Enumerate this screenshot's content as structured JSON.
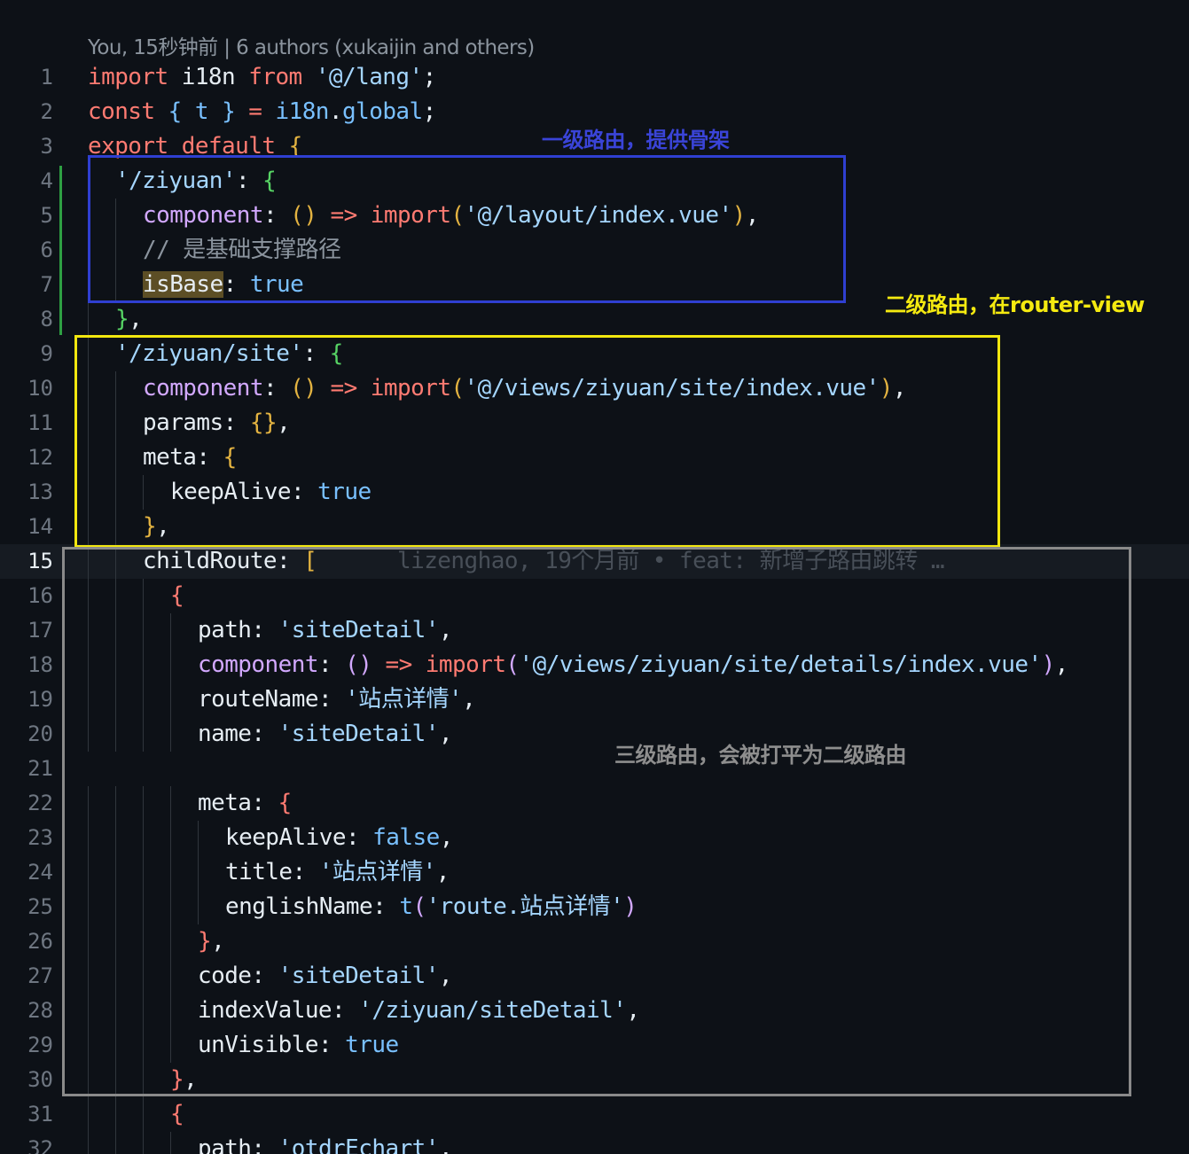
{
  "editor": {
    "codelens": "You, 15秒钟前 | 6 authors (xukaijin and others)",
    "colors": {
      "background": "#0d1117",
      "keyword": "#ff7b72",
      "string": "#a5d6ff",
      "property": "#d2a8ff",
      "boolean": "#79c0ff",
      "comment": "#8b949e",
      "git_added_bar": "#2ea043"
    },
    "current_line": 15,
    "lines": [
      {
        "n": "1",
        "indent": 0,
        "tokens": [
          {
            "t": "import",
            "s": "kw"
          },
          {
            "t": " i18n ",
            "s": "var"
          },
          {
            "t": "from",
            "s": "kw"
          },
          {
            "t": " ",
            "s": "var"
          },
          {
            "t": "'@/lang'",
            "s": "str"
          },
          {
            "t": ";",
            "s": "pun"
          }
        ]
      },
      {
        "n": "2",
        "indent": 0,
        "tokens": [
          {
            "t": "const",
            "s": "kw"
          },
          {
            "t": " ",
            "s": "var"
          },
          {
            "t": "{",
            "s": "b4"
          },
          {
            "t": " t ",
            "s": "bool"
          },
          {
            "t": "}",
            "s": "b4"
          },
          {
            "t": " = ",
            "s": "kw"
          },
          {
            "t": "i18n",
            "s": "bool"
          },
          {
            "t": ".",
            "s": "pun"
          },
          {
            "t": "global",
            "s": "bool"
          },
          {
            "t": ";",
            "s": "pun"
          }
        ]
      },
      {
        "n": "3",
        "indent": 0,
        "tokens": [
          {
            "t": "export",
            "s": "kw"
          },
          {
            "t": " ",
            "s": "var"
          },
          {
            "t": "default",
            "s": "kw"
          },
          {
            "t": " ",
            "s": "var"
          },
          {
            "t": "{",
            "s": "b1"
          }
        ]
      },
      {
        "n": "4",
        "indent": 1,
        "tokens": [
          {
            "t": "'/ziyuan'",
            "s": "str"
          },
          {
            "t": ": ",
            "s": "pun"
          },
          {
            "t": "{",
            "s": "b2"
          }
        ]
      },
      {
        "n": "5",
        "indent": 2,
        "tokens": [
          {
            "t": "component",
            "s": "prop"
          },
          {
            "t": ": ",
            "s": "pun"
          },
          {
            "t": "()",
            "s": "b1"
          },
          {
            "t": " => ",
            "s": "kw"
          },
          {
            "t": "import",
            "s": "kw"
          },
          {
            "t": "(",
            "s": "b1"
          },
          {
            "t": "'@/layout/index.vue'",
            "s": "str"
          },
          {
            "t": ")",
            "s": "b1"
          },
          {
            "t": ",",
            "s": "pun"
          }
        ]
      },
      {
        "n": "6",
        "indent": 2,
        "tokens": [
          {
            "t": "// 是基础支撑路径",
            "s": "com"
          }
        ]
      },
      {
        "n": "7",
        "indent": 2,
        "tokens": [
          {
            "t": "isBase",
            "s": "var",
            "hl": true
          },
          {
            "t": ": ",
            "s": "pun"
          },
          {
            "t": "true",
            "s": "bool"
          }
        ]
      },
      {
        "n": "8",
        "indent": 1,
        "tokens": [
          {
            "t": "}",
            "s": "b2"
          },
          {
            "t": ",",
            "s": "pun"
          }
        ]
      },
      {
        "n": "9",
        "indent": 1,
        "tokens": [
          {
            "t": "'/ziyuan/site'",
            "s": "str"
          },
          {
            "t": ": ",
            "s": "pun"
          },
          {
            "t": "{",
            "s": "b2"
          }
        ]
      },
      {
        "n": "10",
        "indent": 2,
        "tokens": [
          {
            "t": "component",
            "s": "prop"
          },
          {
            "t": ": ",
            "s": "pun"
          },
          {
            "t": "()",
            "s": "b1"
          },
          {
            "t": " => ",
            "s": "kw"
          },
          {
            "t": "import",
            "s": "kw"
          },
          {
            "t": "(",
            "s": "b1"
          },
          {
            "t": "'@/views/ziyuan/site/index.vue'",
            "s": "str"
          },
          {
            "t": ")",
            "s": "b1"
          },
          {
            "t": ",",
            "s": "pun"
          }
        ]
      },
      {
        "n": "11",
        "indent": 2,
        "tokens": [
          {
            "t": "params",
            "s": "var"
          },
          {
            "t": ": ",
            "s": "pun"
          },
          {
            "t": "{}",
            "s": "b1"
          },
          {
            "t": ",",
            "s": "pun"
          }
        ]
      },
      {
        "n": "12",
        "indent": 2,
        "tokens": [
          {
            "t": "meta",
            "s": "var"
          },
          {
            "t": ": ",
            "s": "pun"
          },
          {
            "t": "{",
            "s": "b1"
          }
        ]
      },
      {
        "n": "13",
        "indent": 3,
        "tokens": [
          {
            "t": "keepAlive",
            "s": "var"
          },
          {
            "t": ": ",
            "s": "pun"
          },
          {
            "t": "true",
            "s": "bool"
          }
        ]
      },
      {
        "n": "14",
        "indent": 2,
        "tokens": [
          {
            "t": "}",
            "s": "b1"
          },
          {
            "t": ",",
            "s": "pun"
          }
        ]
      },
      {
        "n": "15",
        "indent": 2,
        "tokens": [
          {
            "t": "childRoute",
            "s": "var"
          },
          {
            "t": ": ",
            "s": "pun"
          },
          {
            "t": "[",
            "s": "b1"
          },
          {
            "t": "      lizenghao, 19个月前 • feat: 新增子路由跳转 …",
            "s": "blame"
          }
        ]
      },
      {
        "n": "16",
        "indent": 3,
        "tokens": [
          {
            "t": "{",
            "s": "b5"
          }
        ]
      },
      {
        "n": "17",
        "indent": 4,
        "tokens": [
          {
            "t": "path",
            "s": "var"
          },
          {
            "t": ": ",
            "s": "pun"
          },
          {
            "t": "'siteDetail'",
            "s": "str"
          },
          {
            "t": ",",
            "s": "pun"
          }
        ]
      },
      {
        "n": "18",
        "indent": 4,
        "tokens": [
          {
            "t": "component",
            "s": "prop"
          },
          {
            "t": ": ",
            "s": "pun"
          },
          {
            "t": "()",
            "s": "b3"
          },
          {
            "t": " => ",
            "s": "kw"
          },
          {
            "t": "import",
            "s": "kw"
          },
          {
            "t": "(",
            "s": "b3"
          },
          {
            "t": "'@/views/ziyuan/site/details/index.vue'",
            "s": "str"
          },
          {
            "t": ")",
            "s": "b3"
          },
          {
            "t": ",",
            "s": "pun"
          }
        ]
      },
      {
        "n": "19",
        "indent": 4,
        "tokens": [
          {
            "t": "routeName",
            "s": "var"
          },
          {
            "t": ": ",
            "s": "pun"
          },
          {
            "t": "'站点详情'",
            "s": "str"
          },
          {
            "t": ",",
            "s": "pun"
          }
        ]
      },
      {
        "n": "20",
        "indent": 4,
        "tokens": [
          {
            "t": "name",
            "s": "var"
          },
          {
            "t": ": ",
            "s": "pun"
          },
          {
            "t": "'siteDetail'",
            "s": "str"
          },
          {
            "t": ",",
            "s": "pun"
          }
        ]
      },
      {
        "n": "21",
        "indent": 0,
        "tokens": []
      },
      {
        "n": "22",
        "indent": 4,
        "tokens": [
          {
            "t": "meta",
            "s": "var"
          },
          {
            "t": ": ",
            "s": "pun"
          },
          {
            "t": "{",
            "s": "b5"
          }
        ]
      },
      {
        "n": "23",
        "indent": 5,
        "tokens": [
          {
            "t": "keepAlive",
            "s": "var"
          },
          {
            "t": ": ",
            "s": "pun"
          },
          {
            "t": "false",
            "s": "bool"
          },
          {
            "t": ",",
            "s": "pun"
          }
        ]
      },
      {
        "n": "24",
        "indent": 5,
        "tokens": [
          {
            "t": "title",
            "s": "var"
          },
          {
            "t": ": ",
            "s": "pun"
          },
          {
            "t": "'站点详情'",
            "s": "str"
          },
          {
            "t": ",",
            "s": "pun"
          }
        ]
      },
      {
        "n": "25",
        "indent": 5,
        "tokens": [
          {
            "t": "englishName",
            "s": "var"
          },
          {
            "t": ": ",
            "s": "pun"
          },
          {
            "t": "t",
            "s": "bool"
          },
          {
            "t": "(",
            "s": "b3"
          },
          {
            "t": "'route.站点详情'",
            "s": "str"
          },
          {
            "t": ")",
            "s": "b3"
          }
        ]
      },
      {
        "n": "26",
        "indent": 4,
        "tokens": [
          {
            "t": "}",
            "s": "b5"
          },
          {
            "t": ",",
            "s": "pun"
          }
        ]
      },
      {
        "n": "27",
        "indent": 4,
        "tokens": [
          {
            "t": "code",
            "s": "var"
          },
          {
            "t": ": ",
            "s": "pun"
          },
          {
            "t": "'siteDetail'",
            "s": "str"
          },
          {
            "t": ",",
            "s": "pun"
          }
        ]
      },
      {
        "n": "28",
        "indent": 4,
        "tokens": [
          {
            "t": "indexValue",
            "s": "var"
          },
          {
            "t": ": ",
            "s": "pun"
          },
          {
            "t": "'/ziyuan/siteDetail'",
            "s": "str"
          },
          {
            "t": ",",
            "s": "pun"
          }
        ]
      },
      {
        "n": "29",
        "indent": 4,
        "tokens": [
          {
            "t": "unVisible",
            "s": "var"
          },
          {
            "t": ": ",
            "s": "pun"
          },
          {
            "t": "true",
            "s": "bool"
          }
        ]
      },
      {
        "n": "30",
        "indent": 3,
        "tokens": [
          {
            "t": "}",
            "s": "b5"
          },
          {
            "t": ",",
            "s": "pun"
          }
        ]
      },
      {
        "n": "31",
        "indent": 3,
        "tokens": [
          {
            "t": "{",
            "s": "b5"
          }
        ]
      },
      {
        "n": "32",
        "indent": 4,
        "tokens": [
          {
            "t": "path",
            "s": "var"
          },
          {
            "t": ": ",
            "s": "pun"
          },
          {
            "t": "'otdrEchart'",
            "s": "str"
          },
          {
            "t": ",",
            "s": "pun"
          }
        ]
      }
    ]
  },
  "annotations": {
    "level1": {
      "label": "一级路由，提供骨架",
      "color": "#2f3fd1"
    },
    "level2": {
      "label": "二级路由，在router-view",
      "color": "#f2e70f"
    },
    "level3": {
      "label": "三级路由，会被打平为二级路由",
      "color": "#8a8a8a"
    }
  }
}
